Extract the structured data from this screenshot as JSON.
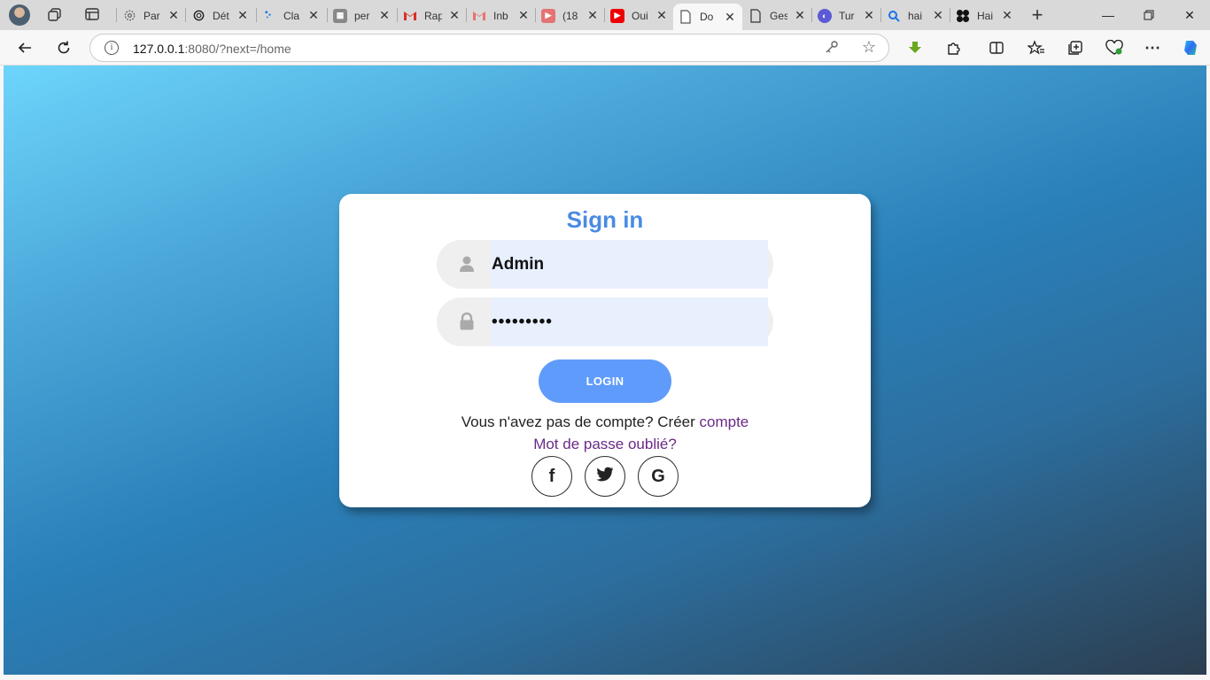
{
  "browser": {
    "tabs": [
      {
        "title": "Par",
        "icon": "gear-icon",
        "active": false
      },
      {
        "title": "Dét",
        "icon": "openai-icon",
        "active": false
      },
      {
        "title": "Cla",
        "icon": "dots-icon",
        "active": false
      },
      {
        "title": "per",
        "icon": "grid-icon",
        "active": false
      },
      {
        "title": "Rap",
        "icon": "gmail-icon",
        "active": false
      },
      {
        "title": "Inb",
        "icon": "gmail-icon",
        "active": false
      },
      {
        "title": "(18",
        "icon": "youtube-icon",
        "active": false
      },
      {
        "title": "Oui",
        "icon": "youtube-icon",
        "active": false
      },
      {
        "title": "Do",
        "icon": "document-icon",
        "active": true
      },
      {
        "title": "Ges",
        "icon": "document-icon",
        "active": false
      },
      {
        "title": "Tur",
        "icon": "globe-icon",
        "active": false
      },
      {
        "title": "hai",
        "icon": "search-icon",
        "active": false
      },
      {
        "title": "Hai",
        "icon": "clover-icon",
        "active": false
      }
    ],
    "url_host": "127.0.0.1",
    "url_rest": ":8080/?next=/home",
    "accent_color": "#4a8be3"
  },
  "login": {
    "title": "Sign in",
    "username_value": "Admin",
    "password_value": "•••••••••",
    "login_button": "LOGIN",
    "signup_prompt": "Vous n'avez pas de compte? Créer ",
    "signup_link": "compte",
    "forgot_link": "Mot de passe oublié?",
    "social": [
      "f",
      "G"
    ]
  }
}
